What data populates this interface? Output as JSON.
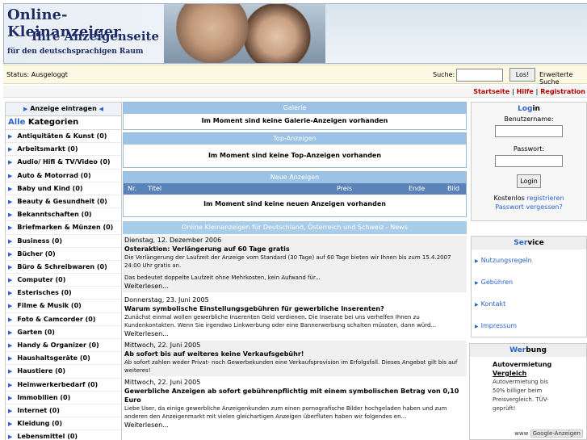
{
  "header": {
    "line1": "Online-Kleinanzeiger",
    "line2": "Ihre Anzeigenseite",
    "line3": "für den deutschsprachigen Raum"
  },
  "statusbar": {
    "status": "Status: Ausgeloggt",
    "search_label": "Suche:",
    "search_value": "",
    "search_button": "Los!",
    "advanced": "Erweiterte Suche"
  },
  "topnav": {
    "home": "Startseite",
    "sep": " | ",
    "help": "Hilfe",
    "registration": "Registration"
  },
  "left": {
    "insert_label": "Anzeige eintragen",
    "heading_prefix": "Alle",
    "heading": " Kategorien",
    "categories": [
      "Antiquitäten & Kunst (0)",
      "Arbeitsmarkt (0)",
      "Audio/ Hifi & TV/Video (0)",
      "Auto & Motorrad (0)",
      "Baby und Kind (0)",
      "Beauty & Gesundheit (0)",
      "Bekanntschaften (0)",
      "Briefmarken & Münzen (0)",
      "Business (0)",
      "Bücher (0)",
      "Büro & Schreibwaren (0)",
      "Computer (0)",
      "Esterisches (0)",
      "Filme & Musik (0)",
      "Foto & Camcorder (0)",
      "Garten (0)",
      "Handy & Organizer (0)",
      "Haushaltsgeräte (0)",
      "Haustiere (0)",
      "Heimwerkerbedarf (0)",
      "Immobilien (0)",
      "Internet (0)",
      "Kleidung (0)",
      "Lebensmittel (0)"
    ]
  },
  "main": {
    "galerie": {
      "title": "Galerie",
      "message": "Im Moment sind keine Galerie-Anzeigen vorhanden"
    },
    "top": {
      "title": "Top-Anzeigen",
      "message": "Im Moment sind keine Top-Anzeigen vorhanden"
    },
    "neue": {
      "title": "Neue Anzeigen",
      "columns": [
        "Nr.",
        "Titel",
        "Preis",
        "Ende",
        "Bild"
      ],
      "message": "Im Moment sind keine neuen Anzeigen vorhanden"
    },
    "news": {
      "heading": "Online Kleinanzeigen für Deutschland, Österreich und Schweiz - News",
      "items": [
        {
          "date": "Dienstag, 12. Dezember 2006",
          "title": "Osteraktion: Verlängerung auf 60 Tage gratis",
          "body": "Die Verlängerung der Laufzeit der Anzeige vom Standard (30 Tage) auf 60 Tage bieten wir Ihnen bis zum 15.4.2007 24:00 Uhr gratis an.",
          "body2": "Das bedeutet doppelte Laufzeit ohne Mehrkosten, kein Aufwand für...",
          "more": "Weiterlesen..."
        },
        {
          "date": "Donnerstag, 23. Juni 2005",
          "title": "Warum symbolische Einstellungsgebühren für gewerbliche Inserenten?",
          "body": "Zunächst einmal wollen gewerbliche Inserenten Geld verdienen. Die Inserate bei uns verhelfen Ihnen zu Kundenkontakten. Wenn Sie irgendwo Linkwerbung oder eine Bannerwerbung schalten müssten, dann würd...",
          "more": "Weiterlesen..."
        },
        {
          "date": "Mittwoch, 22. Juni 2005",
          "title": "Ab sofort bis auf weiteres keine Verkaufsgebühr!",
          "body": "Ab sofort zahlen weder Privat- noch Gewerbekunden eine Verkaufsprovision im Erfolgsfall. Dieses Angebot gilt bis auf weiteres!"
        },
        {
          "date": "Mittwoch, 22. Juni 2005",
          "title": "Gewerbliche Anzeigen ab sofort gebührenpflichtig mit einem symbolischen Betrag von 0,10 Euro",
          "body": "Liebe User, da einige gewerbliche Anzeigenkunden zum einen pornografische Bilder hochgeladen haben und zum anderen den Anzeigenmarkt mit vielen gleichartigen Anzeigen überfluten haben wir folgendes en...",
          "more": "Weiterlesen..."
        }
      ]
    }
  },
  "right": {
    "login": {
      "title_a": "Log",
      "title_b": "in",
      "user_label": "Benutzername:",
      "pass_label": "Passwort:",
      "button": "Login",
      "free": "Kostenlos ",
      "register": "registrieren",
      "forgot": "Passwort vergessen?"
    },
    "service": {
      "title_a": "Ser",
      "title_b": "vice",
      "items": [
        "Nutzungsregeln",
        "Gebühren",
        "Kontakt",
        "Impressum"
      ]
    },
    "werbung": {
      "title_a": "Wer",
      "title_b": "bung",
      "ad_title1": "Autovermietung",
      "ad_title2": "Vergleich",
      "ad_text": [
        "Autovermietung bis",
        "50% billiger beim",
        "Preisvergleich. TÜV-",
        "geprüft!"
      ],
      "google_prefix": "www",
      "google": "Google-Anzeigen"
    }
  }
}
